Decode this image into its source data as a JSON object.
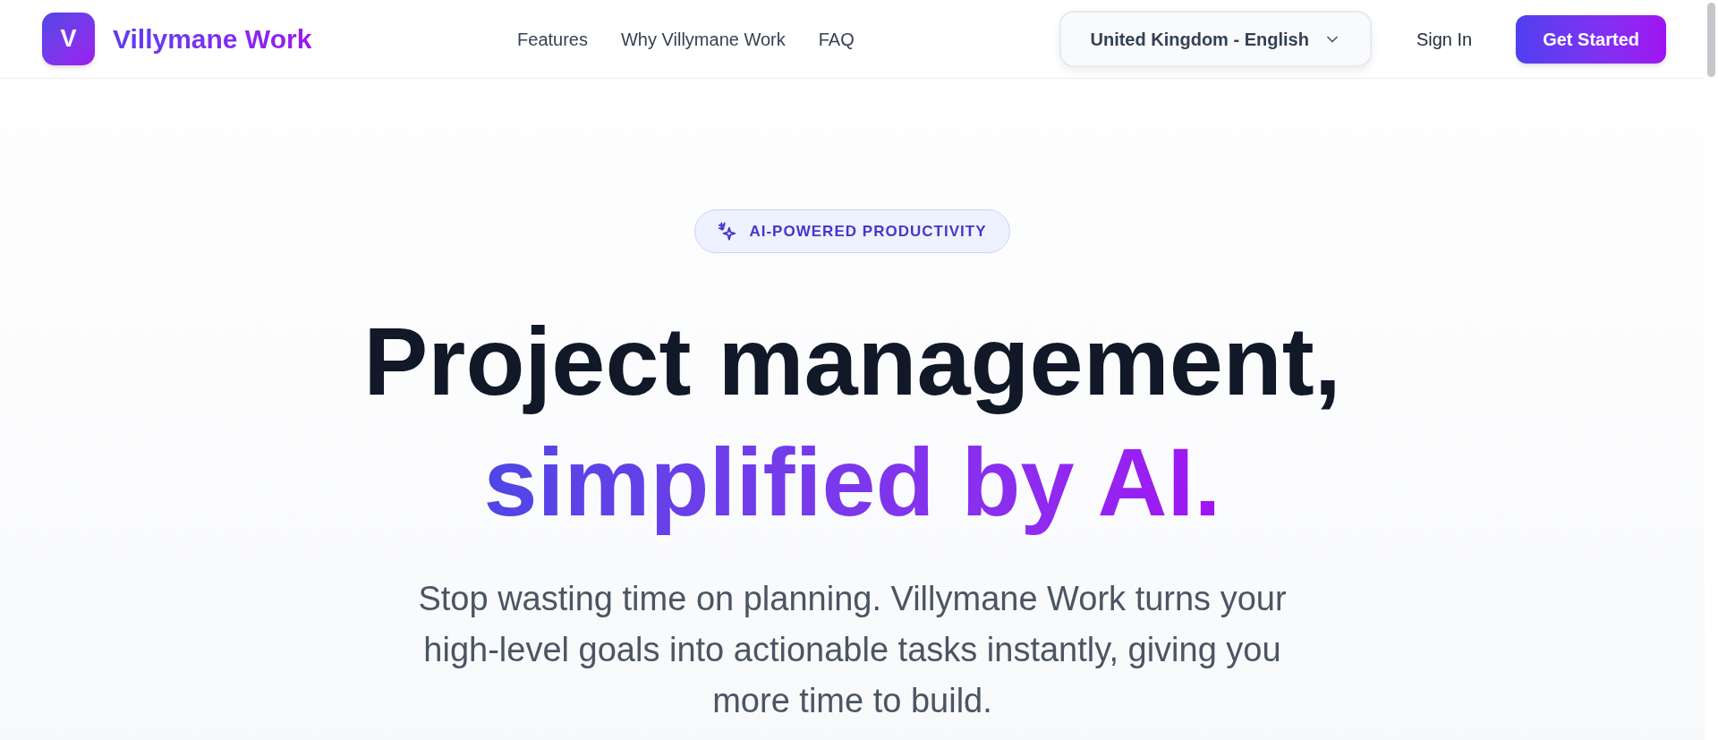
{
  "header": {
    "logo": {
      "letter": "V",
      "name": "Villymane Work"
    },
    "nav": [
      "Features",
      "Why Villymane Work",
      "FAQ"
    ],
    "region_select": {
      "value": "United Kingdom - English"
    },
    "sign_in": "Sign In",
    "cta": "Get Started"
  },
  "hero": {
    "badge": "AI-POWERED PRODUCTIVITY",
    "headline": {
      "text": "Project management,",
      "highlight": "simplified by AI."
    },
    "description": "Stop wasting time on planning. Villymane Work turns your high-level goals into actionable tasks instantly, giving you more time to build."
  }
}
